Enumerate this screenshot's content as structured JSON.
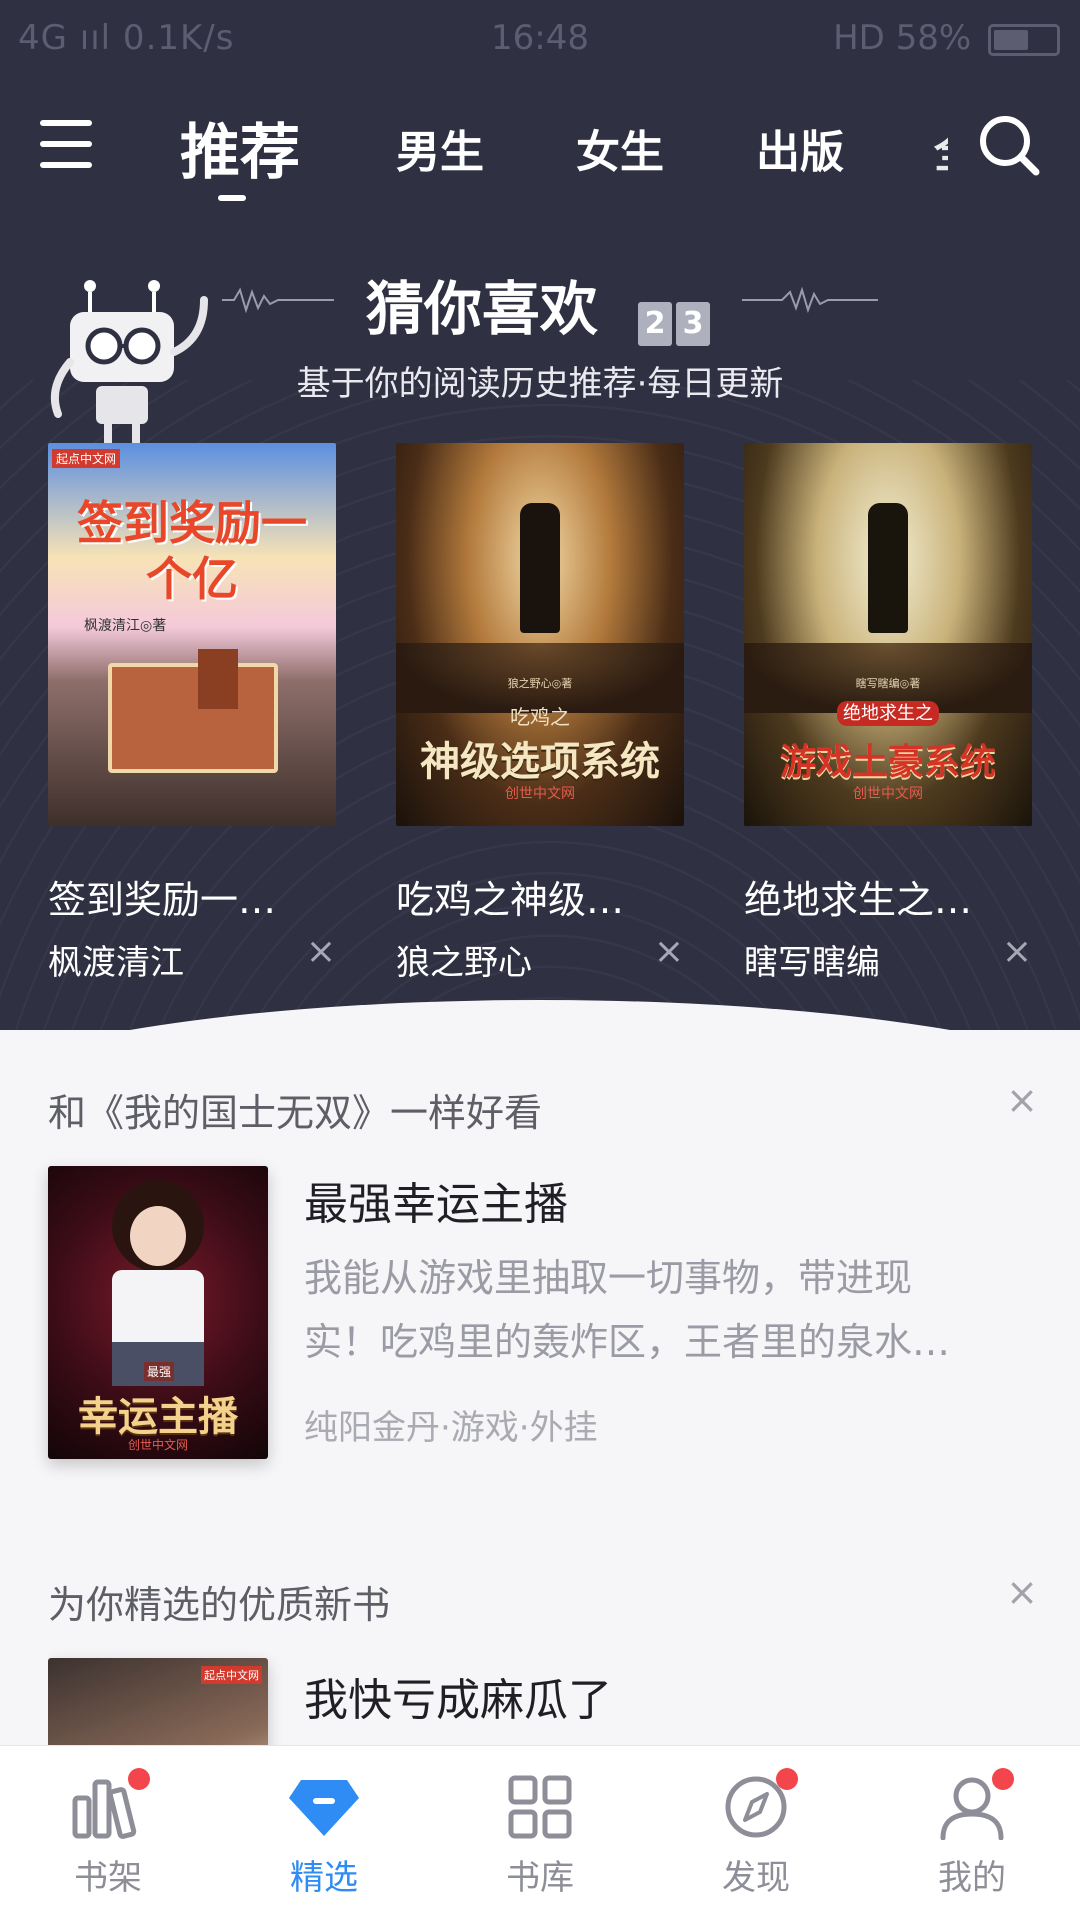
{
  "status_bar": {
    "left": "4G ııl 0.1K/s",
    "time": "16:48",
    "right": "HD 58%"
  },
  "nav": {
    "tabs": [
      "推荐",
      "男生",
      "女生",
      "出版",
      "全"
    ]
  },
  "guess": {
    "title": "猜你喜欢",
    "date_digits": [
      "2",
      "3"
    ],
    "subtitle": "基于你的阅读历史推荐·每日更新",
    "books": [
      {
        "title": "签到奖励一…",
        "author": "枫渡清江",
        "cover_text": "签到奖励一个亿",
        "cover_author": "枫渡清江◎著",
        "publisher": "起点中文网"
      },
      {
        "title": "吃鸡之神级…",
        "author": "狼之野心",
        "cover_text": "神级选项系统",
        "cover_sub": "吃鸡之",
        "cover_author": "狼之野心◎著",
        "publisher": "创世中文网"
      },
      {
        "title": "绝地求生之…",
        "author": "瞎写瞎编",
        "cover_text": "游戏土豪系统",
        "cover_sub": "绝地求生之",
        "cover_author": "瞎写瞎编◎著",
        "publisher": "创世中文网"
      }
    ],
    "close_glyph": "×"
  },
  "similar": {
    "heading": "和《我的国士无双》一样好看",
    "book": {
      "title": "最强幸运主播",
      "desc_line1": "我能从游戏里抽取一切事物，带进现",
      "desc_line2": "实！吃鸡里的轰炸区，王者里的泉水…",
      "meta": "纯阳金丹·游戏·外挂",
      "cover_text": "幸运主播",
      "cover_badge": "最强",
      "publisher": "创世中文网"
    }
  },
  "newbooks": {
    "heading": "为你精选的优质新书",
    "book": {
      "title": "我快亏成麻瓜了",
      "publisher": "起点中文网"
    }
  },
  "tabbar": {
    "items": [
      {
        "label": "书架",
        "icon": "bookshelf-icon",
        "badge": true
      },
      {
        "label": "精选",
        "icon": "diamond-icon",
        "badge": false
      },
      {
        "label": "书库",
        "icon": "grid-icon",
        "badge": false
      },
      {
        "label": "发现",
        "icon": "compass-icon",
        "badge": true
      },
      {
        "label": "我的",
        "icon": "user-icon",
        "badge": true
      }
    ],
    "active": "精选"
  },
  "colors": {
    "header_bg": "#2f3042",
    "accent": "#2f8cf4",
    "badge": "#f2454c"
  }
}
